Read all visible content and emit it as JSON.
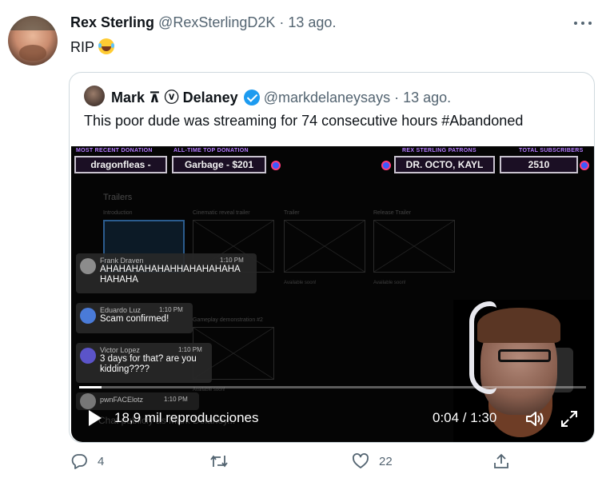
{
  "tweet": {
    "author_name": "Rex Sterling",
    "author_handle": "@RexSterlingD2K",
    "separator": " · ",
    "date": "13 ago.",
    "text": "RIP"
  },
  "quoted_tweet": {
    "author_name_part1": "Mark ",
    "author_name_glyphs": "⊼ ⓥ",
    "author_name_part2": " Delaney",
    "author_handle": "@markdelaneysays",
    "separator": " · ",
    "date": "13 ago.",
    "text": "This poor dude was streaming for 74 consecutive hours #Abandoned"
  },
  "video": {
    "hud": {
      "most_recent_label": "MOST RECENT DONATION",
      "most_recent_value": "dragonfleas -",
      "top_donation_label": "ALL-TIME TOP DONATION",
      "top_donation_value": "Garbage - $201",
      "patrons_label": "REX STERLING PATRONS",
      "patrons_value": "DR. OCTO, KAYL",
      "subscribers_label": "TOTAL SUBSCRIBERS",
      "subscribers_value": "2510"
    },
    "section_title": "Trailers",
    "thumb_labels": [
      "Introduction",
      "Cinematic reveal trailer",
      "Trailer",
      "Release Trailer"
    ],
    "available_text": "Available soon!",
    "second_row_label": "Gameplay demonstration #2",
    "chat": [
      {
        "name": "Frank Draven",
        "time": "1:10 PM",
        "text": "AHAHAHAHAHAHHAHAHAHAHA HAHAHA"
      },
      {
        "name": "Eduardo Luz",
        "time": "1:10 PM",
        "text": "Scam confirmed!"
      },
      {
        "name": "Victor Lopez",
        "time": "1:10 PM",
        "text": "3 days for that? are you kidding????"
      },
      {
        "name": "pwnFACElotz",
        "time": "1:10 PM",
        "text": ""
      }
    ],
    "chat_placeholder": "Chat publicly as Mark Delaney...",
    "views": "18,9 mil reproducciones",
    "time": "0:04 / 1:30",
    "progress_fraction": 0.044
  },
  "actions": {
    "replies": "4",
    "retweets": "",
    "likes": "22"
  },
  "colors": {
    "accent": "#1d9bf0",
    "muted": "#536471",
    "border": "#cfd9de"
  }
}
